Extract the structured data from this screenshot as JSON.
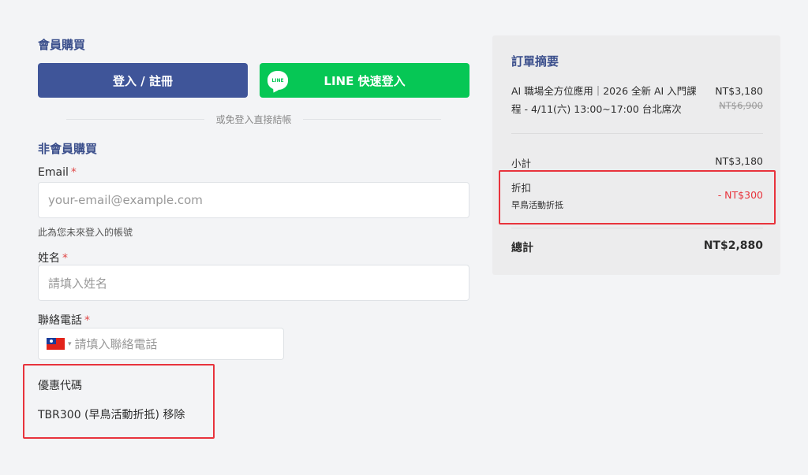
{
  "member": {
    "title": "會員購買",
    "login_label": "登入 / 註冊",
    "line_label": "LINE 快速登入",
    "line_logo": "LINE"
  },
  "divider_text": "或免登入直接結帳",
  "guest": {
    "title": "非會員購買",
    "email_label": "Email",
    "email_placeholder": "your-email@example.com",
    "email_hint": "此為您未來登入的帳號",
    "name_label": "姓名",
    "name_placeholder": "請填入姓名",
    "phone_label": "聯絡電話",
    "phone_placeholder": "請填入聯絡電話",
    "required_mark": "*",
    "country_flag": "taiwan-flag-icon"
  },
  "coupon": {
    "title": "優惠代碼",
    "code_text": "TBR300 (早鳥活動折抵)",
    "remove_label": "移除"
  },
  "summary": {
    "title": "訂單摘要",
    "item_name": "AI 職場全方位應用｜2026 全新 AI 入門課程 - 4/11(六) 13:00~17:00 台北席次",
    "item_price": "NT$3,180",
    "item_original_price": "NT$6,900",
    "subtotal_label": "小計",
    "subtotal_value": "NT$3,180",
    "discount_label": "折扣",
    "discount_note": "早鳥活動折抵",
    "discount_value": "- NT$300",
    "total_label": "總計",
    "total_value": "NT$2,880"
  },
  "colors": {
    "accent": "#3b4f8c",
    "login_button": "#3f5599",
    "line_button": "#06c755",
    "highlight": "#e8333c"
  }
}
